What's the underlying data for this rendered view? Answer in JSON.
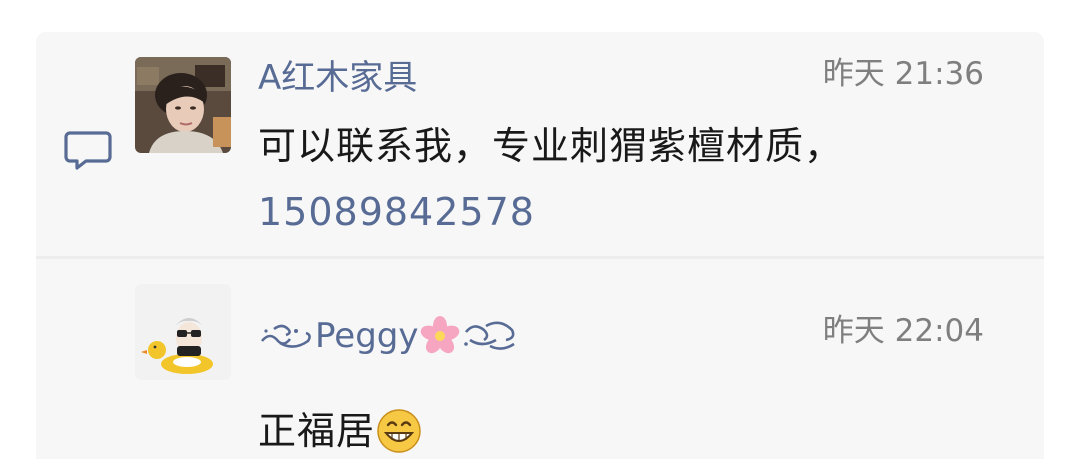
{
  "comments": [
    {
      "author": "A红木家具",
      "time": "昨天 21:36",
      "text": "可以联系我，专业刺猬紫檀材质，",
      "phone": "15089842578",
      "avatar_icon": "woman-photo-avatar"
    },
    {
      "author_prefix_icon": "wind-swirl-icon",
      "author": "Peggy",
      "author_suffix_icons": [
        "cherry-blossom-icon",
        "wind-swirl-icon"
      ],
      "time": "昨天 22:04",
      "text": "正福居",
      "text_emoji": "grinning-face-icon",
      "avatar_icon": "child-with-duck-float-avatar"
    }
  ],
  "icons": {
    "comment": "comment-bubble-icon"
  },
  "colors": {
    "link": "#576b95",
    "time": "#7f7f7f",
    "text": "#191919",
    "panel": "#f7f7f7"
  }
}
